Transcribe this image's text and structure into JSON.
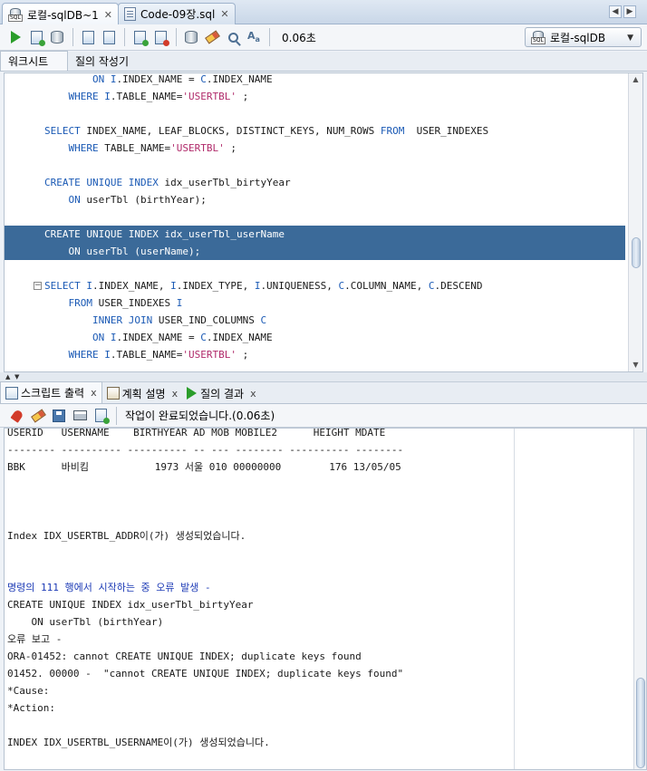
{
  "doc_tabs": [
    {
      "label": "로컬-sqlDB~1",
      "close": "✕"
    },
    {
      "label": "Code-09장.sql",
      "close": "✕"
    }
  ],
  "tab_scroll": {
    "prev": "◀",
    "next": "▶"
  },
  "toolbar": {
    "icons": {
      "run": "run-statement-icon",
      "run_script": "run-script-icon",
      "commit": "commit-icon",
      "rollback": "rollback-icon",
      "explain": "explain-plan-icon",
      "autotrace": "autotrace-icon",
      "clear": "clear-eraser-icon",
      "sql_tuning": "tuning-icon",
      "case": "to-upper-icon"
    },
    "elapsed": "0.06초",
    "connection": "로컬-sqlDB",
    "connection_caret": "▼"
  },
  "editor_tabs": [
    "워크시트",
    "질의 작성기"
  ],
  "editor": {
    "lines": [
      [
        {
          "t": "        ",
          "c": ""
        },
        {
          "t": "ON",
          "c": "kw"
        },
        {
          "t": " ",
          "c": ""
        },
        {
          "t": "I",
          "c": "kw"
        },
        {
          "t": ".INDEX_NAME = ",
          "c": ""
        },
        {
          "t": "C",
          "c": "kw"
        },
        {
          "t": ".INDEX_NAME",
          "c": ""
        }
      ],
      [
        {
          "t": "    ",
          "c": ""
        },
        {
          "t": "WHERE",
          "c": "kw"
        },
        {
          "t": " ",
          "c": ""
        },
        {
          "t": "I",
          "c": "kw"
        },
        {
          "t": ".TABLE_NAME=",
          "c": ""
        },
        {
          "t": "'USERTBL'",
          "c": "str"
        },
        {
          "t": " ;",
          "c": ""
        }
      ],
      [],
      [
        {
          "t": "SELECT",
          "c": "kw"
        },
        {
          "t": " INDEX_NAME, LEAF_BLOCKS, DISTINCT_KEYS, NUM_ROWS ",
          "c": ""
        },
        {
          "t": "FROM",
          "c": "kw"
        },
        {
          "t": "  USER_INDEXES",
          "c": ""
        }
      ],
      [
        {
          "t": "    ",
          "c": ""
        },
        {
          "t": "WHERE",
          "c": "kw"
        },
        {
          "t": " TABLE_NAME=",
          "c": ""
        },
        {
          "t": "'USERTBL'",
          "c": "str"
        },
        {
          "t": " ;",
          "c": ""
        }
      ],
      [],
      [
        {
          "t": "CREATE",
          "c": "kw"
        },
        {
          "t": " ",
          "c": ""
        },
        {
          "t": "UNIQUE",
          "c": "kw"
        },
        {
          "t": " ",
          "c": ""
        },
        {
          "t": "INDEX",
          "c": "kw"
        },
        {
          "t": " idx_userTbl_birtyYear",
          "c": ""
        }
      ],
      [
        {
          "t": "    ",
          "c": ""
        },
        {
          "t": "ON",
          "c": "kw"
        },
        {
          "t": " userTbl (birthYear);",
          "c": ""
        }
      ],
      [],
      [
        {
          "t": "CREATE",
          "c": "kw"
        },
        {
          "t": " ",
          "c": ""
        },
        {
          "t": "UNIQUE",
          "c": "kw"
        },
        {
          "t": " ",
          "c": ""
        },
        {
          "t": "INDEX",
          "c": "kw"
        },
        {
          "t": " idx_userTbl_userName",
          "c": ""
        }
      ],
      [
        {
          "t": "    ",
          "c": ""
        },
        {
          "t": "ON",
          "c": "kw"
        },
        {
          "t": " userTbl (userName);",
          "c": ""
        }
      ],
      [],
      [
        {
          "t": "SELECT",
          "c": "kw"
        },
        {
          "t": " ",
          "c": ""
        },
        {
          "t": "I",
          "c": "kw"
        },
        {
          "t": ".INDEX_NAME, ",
          "c": ""
        },
        {
          "t": "I",
          "c": "kw"
        },
        {
          "t": ".INDEX_TYPE, ",
          "c": ""
        },
        {
          "t": "I",
          "c": "kw"
        },
        {
          "t": ".UNIQUENESS, ",
          "c": ""
        },
        {
          "t": "C",
          "c": "kw"
        },
        {
          "t": ".COLUMN_NAME, ",
          "c": ""
        },
        {
          "t": "C",
          "c": "kw"
        },
        {
          "t": ".DESCEND",
          "c": ""
        }
      ],
      [
        {
          "t": "    ",
          "c": ""
        },
        {
          "t": "FROM",
          "c": "kw"
        },
        {
          "t": " USER_INDEXES ",
          "c": ""
        },
        {
          "t": "I",
          "c": "kw"
        }
      ],
      [
        {
          "t": "        ",
          "c": ""
        },
        {
          "t": "INNER",
          "c": "kw"
        },
        {
          "t": " ",
          "c": ""
        },
        {
          "t": "JOIN",
          "c": "kw"
        },
        {
          "t": " USER_IND_COLUMNS ",
          "c": ""
        },
        {
          "t": "C",
          "c": "kw"
        }
      ],
      [
        {
          "t": "        ",
          "c": ""
        },
        {
          "t": "ON",
          "c": "kw"
        },
        {
          "t": " ",
          "c": ""
        },
        {
          "t": "I",
          "c": "kw"
        },
        {
          "t": ".INDEX_NAME = ",
          "c": ""
        },
        {
          "t": "C",
          "c": "kw"
        },
        {
          "t": ".INDEX_NAME",
          "c": ""
        }
      ],
      [
        {
          "t": "    ",
          "c": ""
        },
        {
          "t": "WHERE",
          "c": "kw"
        },
        {
          "t": " ",
          "c": ""
        },
        {
          "t": "I",
          "c": "kw"
        },
        {
          "t": ".TABLE_NAME=",
          "c": ""
        },
        {
          "t": "'USERTBL'",
          "c": "str"
        },
        {
          "t": " ;",
          "c": ""
        }
      ]
    ],
    "selected_lines": [
      9,
      10
    ],
    "fold_line": 12,
    "fold_symbol": "−",
    "scroll_up": "▲",
    "scroll_down": "▼",
    "scroll_position": 0.62
  },
  "splitter": {
    "up": "▲",
    "down": "▼"
  },
  "output_tabs": [
    {
      "label": "스크립트 출력",
      "close": "x",
      "icon": "script-output-icon"
    },
    {
      "label": "계획 설명",
      "close": "x",
      "icon": "explain-plan-icon"
    },
    {
      "label": "질의 결과",
      "close": "x",
      "icon": "query-result-icon"
    }
  ],
  "output_toolbar": {
    "icons": [
      "pin-icon",
      "clear-eraser-icon",
      "save-icon",
      "print-icon",
      "open-icon"
    ],
    "status": "작업이 완료되었습니다.(0.06초)"
  },
  "output": {
    "lines": [
      {
        "text": "USERID   USERNAME    BIRTHYEAR AD MOB MOBILE2      HEIGHT MDATE",
        "color": ""
      },
      {
        "text": "-------- ---------- ---------- -- --- -------- ---------- --------",
        "color": ""
      },
      {
        "text": "BBK      바비킴           1973 서울 010 00000000        176 13/05/05",
        "color": ""
      },
      {
        "text": "",
        "color": ""
      },
      {
        "text": "",
        "color": ""
      },
      {
        "text": "",
        "color": ""
      },
      {
        "text": "Index IDX_USERTBL_ADDR이(가) 생성되었습니다.",
        "color": ""
      },
      {
        "text": "",
        "color": ""
      },
      {
        "text": "",
        "color": ""
      },
      {
        "text": "명령의 111 행에서 시작하는 중 오류 발생 -",
        "color": "blue"
      },
      {
        "text": "CREATE UNIQUE INDEX idx_userTbl_birtyYear",
        "color": ""
      },
      {
        "text": "    ON userTbl (birthYear)",
        "color": ""
      },
      {
        "text": "오류 보고 -",
        "color": ""
      },
      {
        "text": "ORA-01452: cannot CREATE UNIQUE INDEX; duplicate keys found",
        "color": ""
      },
      {
        "text": "01452. 00000 -  \"cannot CREATE UNIQUE INDEX; duplicate keys found\"",
        "color": ""
      },
      {
        "text": "*Cause:",
        "color": ""
      },
      {
        "text": "*Action:",
        "color": ""
      },
      {
        "text": "",
        "color": ""
      },
      {
        "text": "INDEX IDX_USERTBL_USERNAME이(가) 생성되었습니다.",
        "color": ""
      }
    ]
  }
}
